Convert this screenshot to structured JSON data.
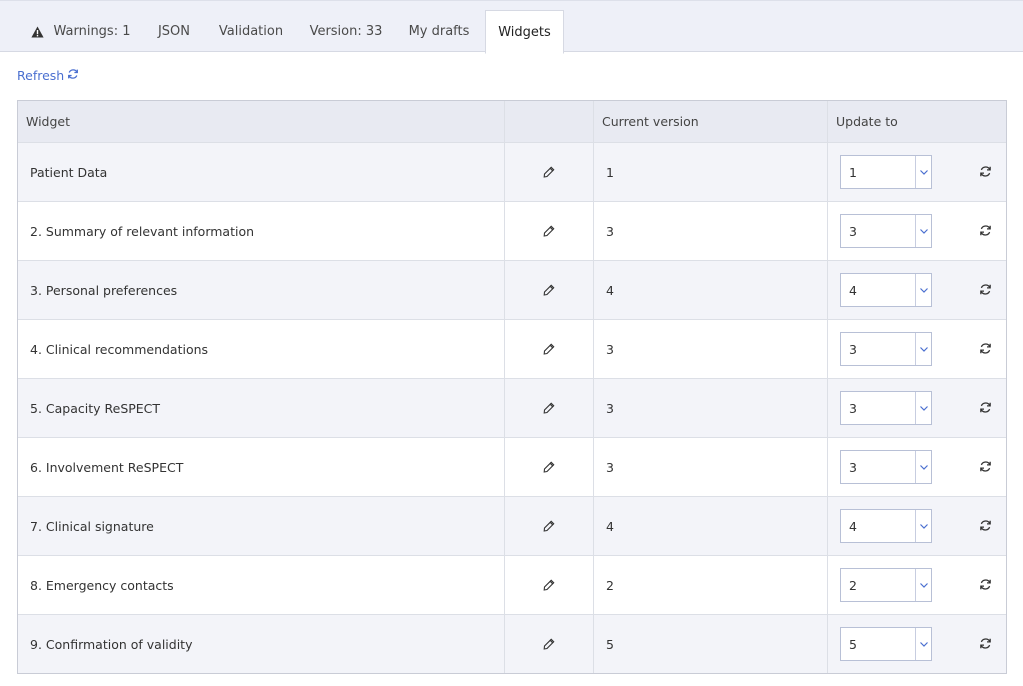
{
  "tabs": [
    {
      "label": "Warnings: 1",
      "icon": "warning-icon"
    },
    {
      "label": "JSON"
    },
    {
      "label": "Validation"
    },
    {
      "label": "Version: 33"
    },
    {
      "label": "My drafts"
    },
    {
      "label": "Widgets",
      "active": true
    }
  ],
  "refresh_label": "Refresh",
  "table": {
    "headers": [
      "Widget",
      "",
      "Current version",
      "Update to"
    ],
    "rows": [
      {
        "name": "Patient Data",
        "current": "1",
        "update": "1"
      },
      {
        "name": "2. Summary of relevant information",
        "current": "3",
        "update": "3"
      },
      {
        "name": "3. Personal preferences",
        "current": "4",
        "update": "4"
      },
      {
        "name": "4. Clinical recommendations",
        "current": "3",
        "update": "3"
      },
      {
        "name": "5. Capacity ReSPECT",
        "current": "3",
        "update": "3"
      },
      {
        "name": "6. Involvement ReSPECT",
        "current": "3",
        "update": "3"
      },
      {
        "name": "7. Clinical signature",
        "current": "4",
        "update": "4"
      },
      {
        "name": "8. Emergency contacts",
        "current": "2",
        "update": "2"
      },
      {
        "name": "9. Confirmation of validity",
        "current": "5",
        "update": "5"
      }
    ]
  },
  "colors": {
    "accent": "#4a6fd0",
    "tab_bar": "#eef0f8",
    "header_bg": "#e8eaf2",
    "row_alt": "#f3f4f9"
  }
}
